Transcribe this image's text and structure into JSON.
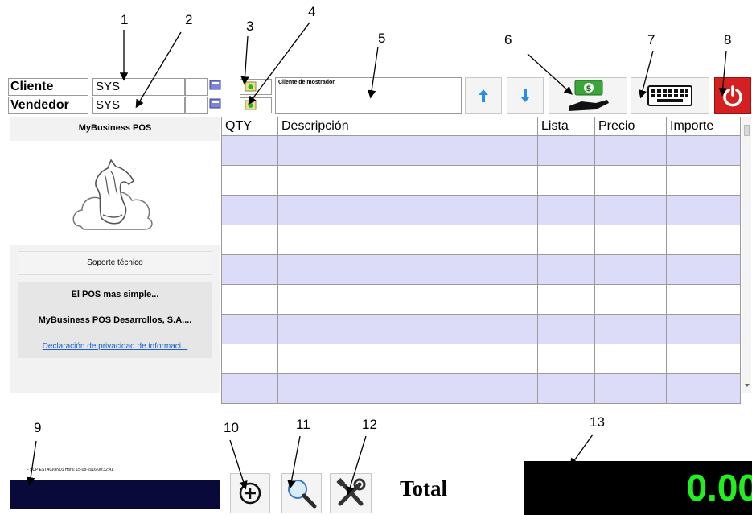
{
  "callouts": [
    "1",
    "2",
    "3",
    "4",
    "5",
    "6",
    "7",
    "8",
    "9",
    "10",
    "11",
    "12",
    "13"
  ],
  "header": {
    "cliente_label": "Cliente",
    "cliente_value": "SYS",
    "vendedor_label": "Vendedor",
    "vendedor_value": "SYS",
    "client_note": "Cliente de mostrador"
  },
  "sidebar": {
    "title": "MyBusiness POS",
    "support_button": "Soporte técnico",
    "tagline": "El POS mas simple...",
    "company": "MyBusiness POS Desarrollos, S.A....",
    "privacy_link": "Declaración de privacidad de informaci..."
  },
  "table": {
    "columns": [
      "QTY",
      "Descripción",
      "Lista",
      "Precio",
      "Importe"
    ],
    "row_count": 9
  },
  "status": {
    "text": "- SUP ESTACION01 Hora: 15-08-2016 00:32:41"
  },
  "totals": {
    "label": "Total",
    "value": "0.00"
  },
  "icons": {
    "up": "arrow-up-icon",
    "down": "arrow-down-icon",
    "pay": "cash-hand-icon",
    "keyboard": "keyboard-icon",
    "power": "power-icon",
    "add": "plus-circle-icon",
    "search": "magnifier-icon",
    "tools": "tools-icon"
  },
  "colors": {
    "row_alt": "#dcdcf8",
    "power_bg": "#d42020",
    "total_fg": "#22ee22",
    "status_bg": "#0a0a3a"
  }
}
